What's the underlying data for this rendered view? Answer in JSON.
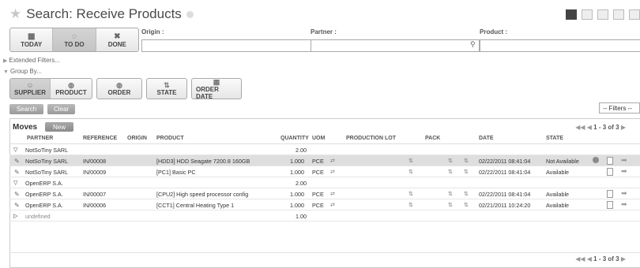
{
  "header": {
    "title": "Search: Receive Products"
  },
  "quick_filters": [
    {
      "label": "TODAY",
      "icon": "calendar-icon"
    },
    {
      "label": "TO DO",
      "icon": "todo-icon",
      "active": true
    },
    {
      "label": "DONE",
      "icon": "close-icon"
    }
  ],
  "search_fields": {
    "origin_label": "Origin :",
    "partner_label": "Partner :",
    "product_label": "Product :",
    "origin_value": "",
    "partner_value": "",
    "product_value": ""
  },
  "extended_filters_label": "Extended Filters...",
  "group_by_label": "Group By...",
  "group_by_buttons": [
    {
      "label": "SUPPLIER",
      "active": true
    },
    {
      "label": "PRODUCT"
    },
    {
      "label": "ORDER"
    },
    {
      "label": "STATE"
    },
    {
      "label": "ORDER DATE"
    }
  ],
  "search_button": "Search",
  "clear_button": "Clear",
  "filters_select": "-- Filters --",
  "list": {
    "title": "Moves",
    "new_button": "New",
    "pager_top": "1 - 3 of 3",
    "pager_bottom": "1 - 3 of 3",
    "columns": {
      "partner": "PARTNER",
      "reference": "REFERENCE",
      "origin": "ORIGIN",
      "product": "PRODUCT",
      "quantity": "QUANTITY",
      "uom": "UOM",
      "production_lot": "PRODUCTION LOT",
      "pack": "PACK",
      "date": "DATE",
      "state": "STATE"
    },
    "rows": [
      {
        "type": "group",
        "partner": "NotSoTiny SARL",
        "quantity": "2.00"
      },
      {
        "type": "line",
        "partner": "NotSoTiny SARL",
        "reference": "IN/00008",
        "product": "[HDD3] HDD Seagate 7200.8 160GB",
        "quantity": "1.000",
        "uom": "PCE",
        "date": "02/22/2011 08:41:04",
        "state": "Not Available",
        "selected": true
      },
      {
        "type": "line",
        "partner": "NotSoTiny SARL",
        "reference": "IN/00009",
        "product": "[PC1] Basic PC",
        "quantity": "1.000",
        "uom": "PCE",
        "date": "02/22/2011 08:41:04",
        "state": "Available"
      },
      {
        "type": "group",
        "partner": "OpenERP S.A.",
        "quantity": "2.00"
      },
      {
        "type": "line",
        "partner": "OpenERP S.A.",
        "reference": "IN/00007",
        "product": "[CPU2] High speed processor config",
        "quantity": "1.000",
        "uom": "PCE",
        "date": "02/22/2011 08:41:04",
        "state": "Available"
      },
      {
        "type": "line",
        "partner": "OpenERP S.A.",
        "reference": "IN/00006",
        "product": "[CCT1] Central Heating Type 1",
        "quantity": "1.000",
        "uom": "PCE",
        "date": "02/21/2011 10:24:20",
        "state": "Available"
      },
      {
        "type": "group-collapsed",
        "partner": "undefined",
        "quantity": "1.00"
      }
    ]
  }
}
